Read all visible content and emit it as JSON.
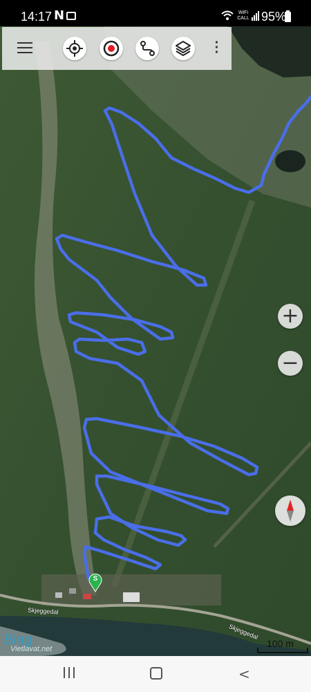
{
  "status_bar": {
    "time": "14:17",
    "notification_letter": "N",
    "wifi_label": "WiFi CALL",
    "battery_percent": "95%"
  },
  "toolbar": {
    "buttons": [
      {
        "name": "menu",
        "icon": "menu-icon"
      },
      {
        "name": "locate",
        "icon": "crosshair-icon"
      },
      {
        "name": "record",
        "icon": "record-icon"
      },
      {
        "name": "route",
        "icon": "route-icon"
      },
      {
        "name": "layers",
        "icon": "layers-icon"
      },
      {
        "name": "more",
        "icon": "more-vertical-icon"
      }
    ]
  },
  "map": {
    "track_color": "#4a6ee8",
    "start_marker_label": "S",
    "start_marker_color": "#2bb24c",
    "place_labels": [
      "Skjeggedal",
      "Skjeggedal"
    ],
    "attribution": "Bing",
    "credit": "Vietlavat.net",
    "scale_label": "100 m"
  },
  "zoom": {
    "in_label": "+",
    "out_label": "−"
  },
  "compass": {
    "icon": "compass-icon"
  },
  "nav_bar": {
    "recent_icon": "recent-apps-icon",
    "home_icon": "home-icon",
    "back_label": "<"
  }
}
